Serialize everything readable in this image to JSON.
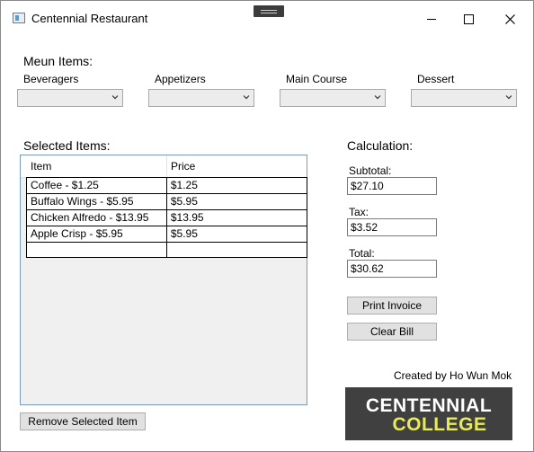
{
  "window": {
    "title": "Centennial Restaurant"
  },
  "menu": {
    "heading": "Meun Items:",
    "categories": [
      {
        "label": "Beveragers",
        "value": ""
      },
      {
        "label": "Appetizers",
        "value": ""
      },
      {
        "label": "Main Course",
        "value": ""
      },
      {
        "label": "Dessert",
        "value": ""
      }
    ]
  },
  "selected": {
    "heading": "Selected Items:",
    "columns": [
      "Item",
      "Price"
    ],
    "rows": [
      [
        "Coffee - $1.25",
        "$1.25"
      ],
      [
        "Buffalo Wings - $5.95",
        "$5.95"
      ],
      [
        "Chicken Alfredo - $13.95",
        "$13.95"
      ],
      [
        "Apple Crisp - $5.95",
        "$5.95"
      ],
      [
        "",
        ""
      ]
    ],
    "remove_label": "Remove Selected Item"
  },
  "calculation": {
    "heading": "Calculation:",
    "subtotal_label": "Subtotal:",
    "subtotal_value": "$27.10",
    "tax_label": "Tax:",
    "tax_value": "$3.52",
    "total_label": "Total:",
    "total_value": "$30.62",
    "print_label": "Print Invoice",
    "clear_label": "Clear Bill"
  },
  "footer": {
    "credit": "Created by Ho Wun Mok",
    "logo_line1": "CENTENNIAL",
    "logo_line2": "COLLEGE"
  },
  "icons": {
    "app": "app-window-icon",
    "minimize": "minimize-icon",
    "maximize": "maximize-icon",
    "close": "close-icon",
    "dropdown": "chevron-down-icon"
  },
  "colors": {
    "logo_background": "#404040",
    "logo_primary": "#ffffff",
    "logo_accent": "#e7ea5a",
    "listview_border": "#7a9ab9",
    "button_face": "#e1e1e1"
  }
}
